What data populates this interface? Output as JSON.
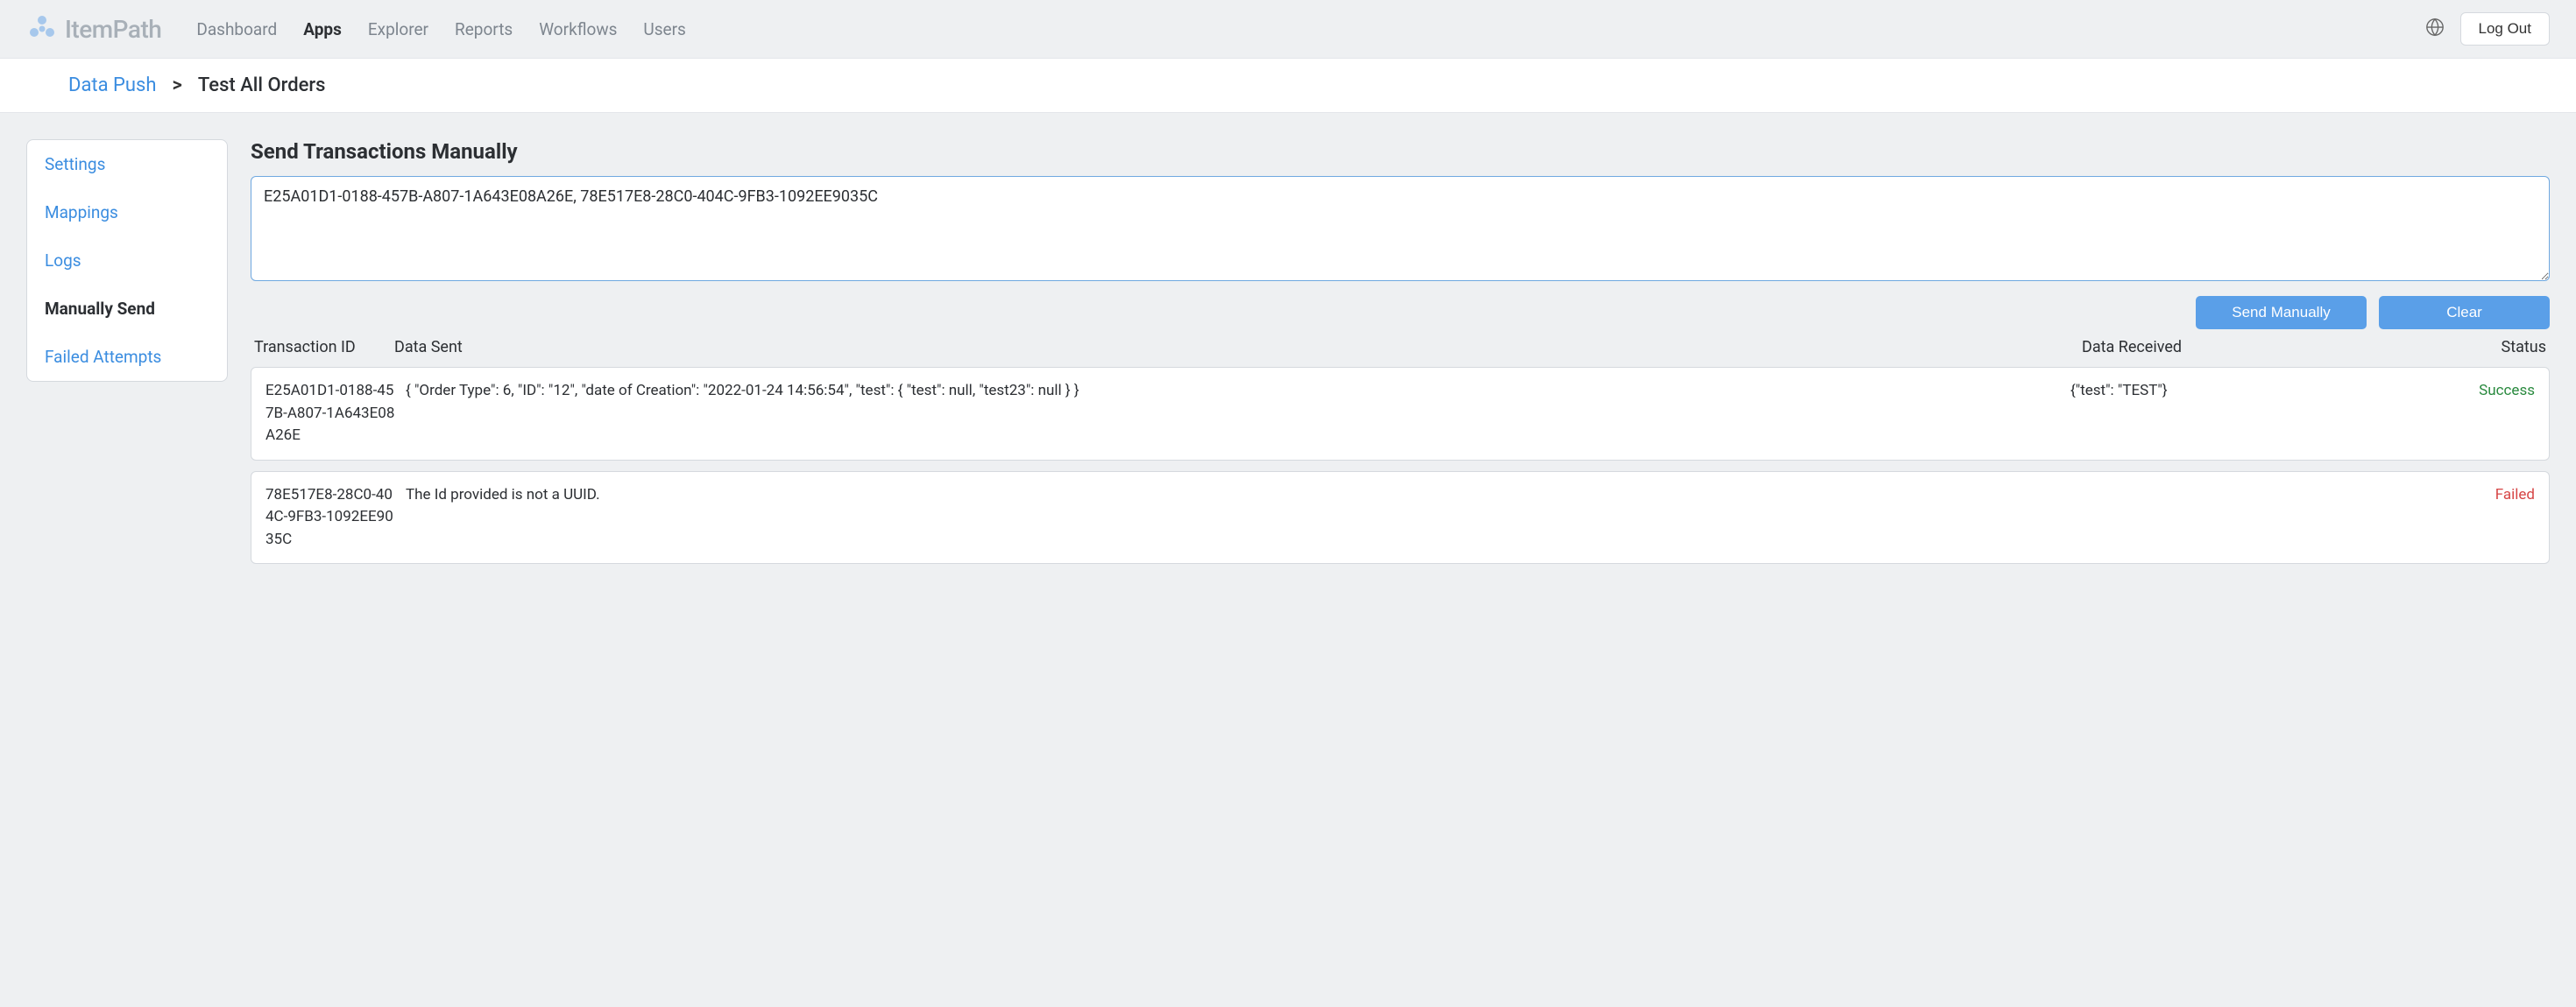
{
  "brand": "ItemPath",
  "nav": {
    "items": [
      "Dashboard",
      "Apps",
      "Explorer",
      "Reports",
      "Workflows",
      "Users"
    ],
    "active_index": 1
  },
  "logout_label": "Log Out",
  "breadcrumb": {
    "parent": "Data Push",
    "separator": ">",
    "current": "Test All Orders"
  },
  "sidebar": {
    "items": [
      "Settings",
      "Mappings",
      "Logs",
      "Manually Send",
      "Failed Attempts"
    ],
    "active_index": 3
  },
  "page_title": "Send Transactions Manually",
  "input_value": "E25A01D1-0188-457B-A807-1A643E08A26E, 78E517E8-28C0-404C-9FB3-1092EE9035C",
  "buttons": {
    "send": "Send Manually",
    "clear": "Clear"
  },
  "table": {
    "headers": {
      "transaction_id": "Transaction ID",
      "data_sent": "Data Sent",
      "data_received": "Data Received",
      "status": "Status"
    },
    "rows": [
      {
        "transaction_id": "E25A01D1-0188-457B-A807-1A643E08A26E",
        "data_sent": "{ \"Order Type\": 6, \"ID\": \"12\", \"date of Creation\": \"2022-01-24 14:56:54\", \"test\": { \"test\": null, \"test23\": null } }",
        "data_received": "{\"test\": \"TEST\"}",
        "status": "Success",
        "status_class": "status-success"
      },
      {
        "transaction_id": "78E517E8-28C0-404C-9FB3-1092EE9035C",
        "data_sent": "The Id provided is not a UUID.",
        "data_received": "",
        "status": "Failed",
        "status_class": "status-failed"
      }
    ]
  }
}
